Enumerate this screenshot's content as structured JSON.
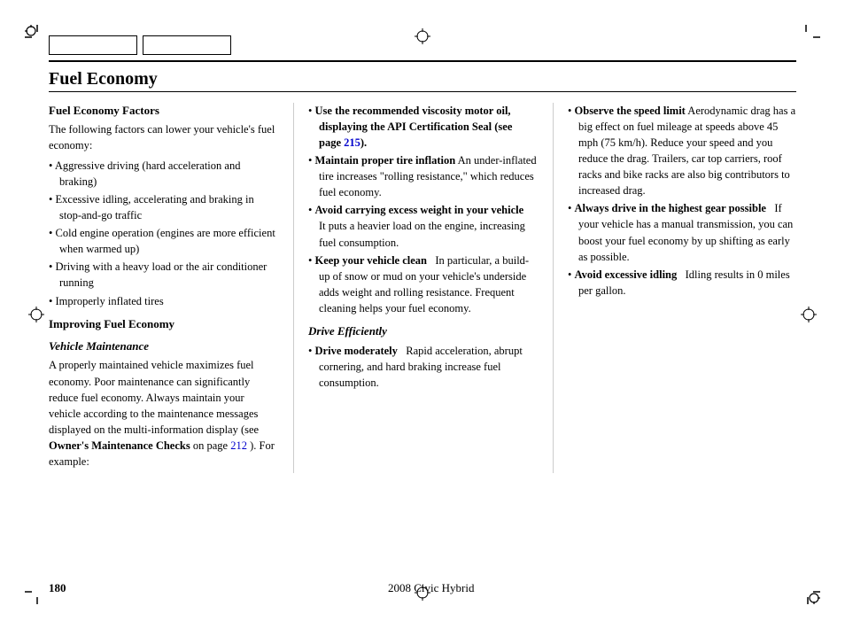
{
  "page": {
    "title": "Fuel Economy",
    "footer": {
      "page_number": "180",
      "center_text": "2008  Civic  Hybrid"
    }
  },
  "col1": {
    "heading1": "Fuel Economy Factors",
    "intro": "The following factors can lower your vehicle's fuel economy:",
    "factors": [
      "Aggressive driving (hard acceleration and braking)",
      "Excessive idling, accelerating and braking in stop-and-go traffic",
      "Cold engine operation (engines are more efficient when warmed up)",
      "Driving with a heavy load or the air conditioner running",
      "Improperly inflated tires"
    ],
    "heading2": "Improving Fuel Economy",
    "heading3": "Vehicle Maintenance",
    "maintenance_text": "A properly maintained vehicle maximizes fuel economy. Poor maintenance can significantly reduce fuel economy. Always maintain your vehicle according to the maintenance messages displayed on the multi-information display (see ",
    "maintenance_bold1": "Owner's Maintenance Checks",
    "maintenance_text2": " on page ",
    "maintenance_link": "212",
    "maintenance_text3": " ). For example:"
  },
  "col2": {
    "items": [
      {
        "bold": "Use the recommended viscosity motor oil, displaying the API Certification Seal (see page ",
        "link": "215",
        "link_end": ").",
        "regular": ""
      },
      {
        "bold": "Maintain proper tire inflation",
        "regular": " An under-inflated tire increases \"rolling resistance,\" which reduces fuel economy."
      },
      {
        "bold": "Avoid carrying excess weight in your vehicle",
        "regular": "   It puts a heavier load on the engine, increasing fuel consumption."
      },
      {
        "bold": "Keep your vehicle clean",
        "regular": "   In particular, a build-up of snow or mud on your vehicle's underside adds weight and rolling resistance. Frequent cleaning helps your fuel economy."
      }
    ],
    "drive_heading": "Drive Efficiently",
    "drive_items": [
      {
        "bold": "Drive moderately",
        "regular": "   Rapid acceleration, abrupt cornering, and hard braking increase fuel consumption."
      }
    ]
  },
  "col3": {
    "items": [
      {
        "bold": "Observe the speed limit",
        "regular": " Aerodynamic drag has a big effect on fuel mileage at speeds above 45 mph (75 km/h). Reduce your speed and you reduce the drag. Trailers, car top carriers, roof racks and bike racks are also big contributors to increased drag."
      },
      {
        "bold": "Always drive in the highest gear possible",
        "regular": "   If your vehicle has a manual transmission, you can boost your fuel economy by up shifting as early as possible."
      },
      {
        "bold": "Avoid excessive idling",
        "regular": "   Idling results in 0 miles per gallon."
      }
    ]
  }
}
